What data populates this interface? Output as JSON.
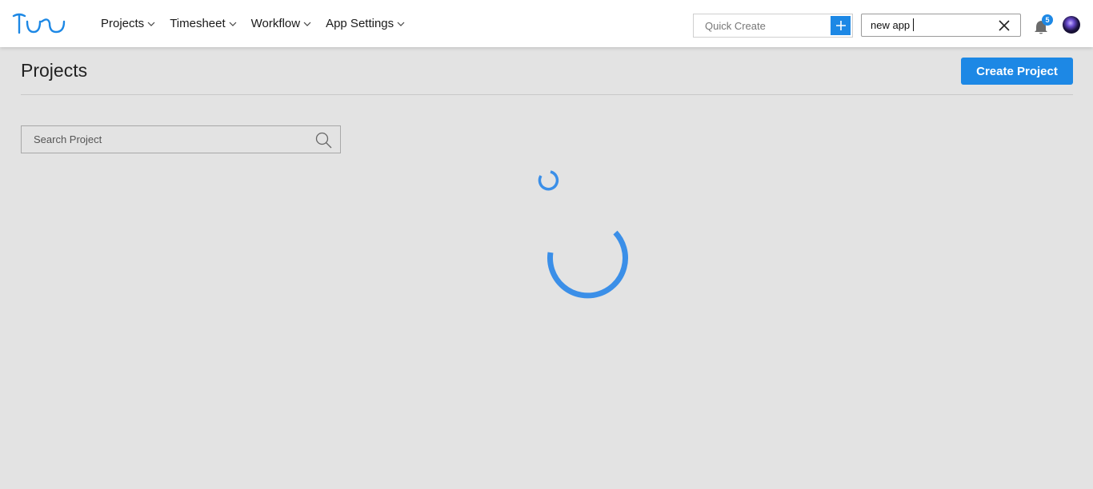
{
  "nav": {
    "items": [
      {
        "label": "Projects"
      },
      {
        "label": "Timesheet"
      },
      {
        "label": "Workflow"
      },
      {
        "label": "App Settings"
      }
    ]
  },
  "quick_create": {
    "placeholder": "Quick Create"
  },
  "top_search": {
    "value": "new app"
  },
  "notifications": {
    "count": "5"
  },
  "page": {
    "title": "Projects",
    "create_button_label": "Create Project",
    "search_placeholder": "Search Project"
  },
  "colors": {
    "accent": "#1d88e5",
    "spinner": "#3b8fe8",
    "background": "#e3e3e3"
  },
  "icons": [
    "logo-icon",
    "chevron-down-icon",
    "plus-icon",
    "close-icon",
    "bell-icon",
    "search-icon",
    "spinner-icon"
  ]
}
